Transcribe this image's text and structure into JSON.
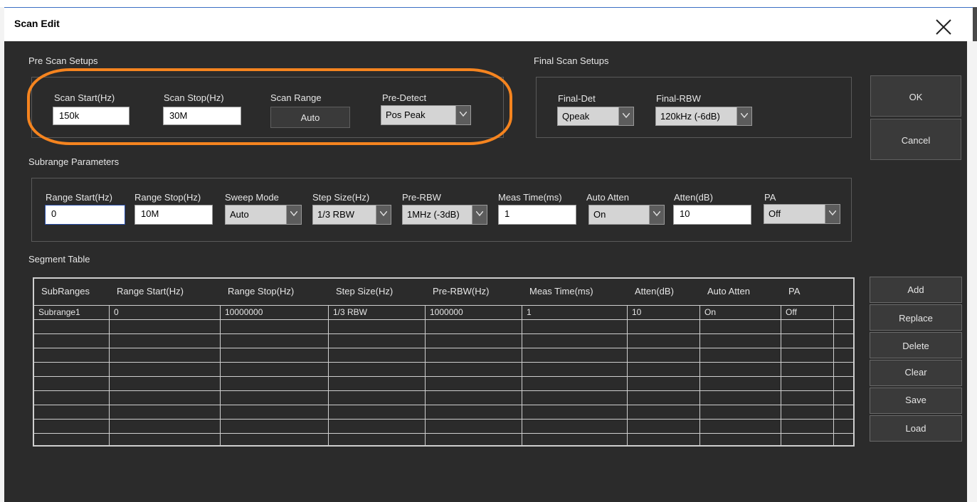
{
  "window": {
    "title": "Scan Edit",
    "close_icon": "close-icon"
  },
  "pre_scan": {
    "group_label": "Pre Scan Setups",
    "scan_start": {
      "label": "Scan Start(Hz)",
      "value": "150k"
    },
    "scan_stop": {
      "label": "Scan Stop(Hz)",
      "value": "30M"
    },
    "scan_range": {
      "label": "Scan Range",
      "button": "Auto"
    },
    "pre_detect": {
      "label": "Pre-Detect",
      "value": "Pos Peak"
    }
  },
  "final_scan": {
    "group_label": "Final Scan Setups",
    "final_det": {
      "label": "Final-Det",
      "value": "Qpeak"
    },
    "final_rbw": {
      "label": "Final-RBW",
      "value": "120kHz (-6dB)"
    }
  },
  "dialog_buttons": {
    "ok": "OK",
    "cancel": "Cancel"
  },
  "subrange": {
    "group_label": "Subrange Parameters",
    "range_start": {
      "label": "Range Start(Hz)",
      "value": "0"
    },
    "range_stop": {
      "label": "Range Stop(Hz)",
      "value": "10M"
    },
    "sweep_mode": {
      "label": "Sweep Mode",
      "value": "Auto"
    },
    "step_size": {
      "label": "Step Size(Hz)",
      "value": "1/3 RBW"
    },
    "pre_rbw": {
      "label": "Pre-RBW",
      "value": "1MHz (-3dB)"
    },
    "meas_time": {
      "label": "Meas Time(ms)",
      "value": "1"
    },
    "auto_atten": {
      "label": "Auto Atten",
      "value": "On"
    },
    "atten": {
      "label": "Atten(dB)",
      "value": "10"
    },
    "pa": {
      "label": "PA",
      "value": "Off"
    }
  },
  "segment_table": {
    "label": "Segment Table",
    "columns": [
      "SubRanges",
      "Range Start(Hz)",
      "Range Stop(Hz)",
      "Step Size(Hz)",
      "Pre-RBW(Hz)",
      "Meas Time(ms)",
      "Atten(dB)",
      "Auto Atten",
      "PA"
    ],
    "rows": [
      [
        "Subrange1",
        "0",
        "10000000",
        "1/3 RBW",
        "1000000",
        "1",
        "10",
        "On",
        "Off"
      ]
    ]
  },
  "table_buttons": {
    "add": "Add",
    "replace": "Replace",
    "delete": "Delete",
    "clear": "Clear",
    "save": "Save",
    "load": "Load"
  },
  "colors": {
    "background": "#2b2b2b",
    "highlight": "#f5841f",
    "input_bg": "#ffffff",
    "combo_bg": "#d4d4d4"
  }
}
